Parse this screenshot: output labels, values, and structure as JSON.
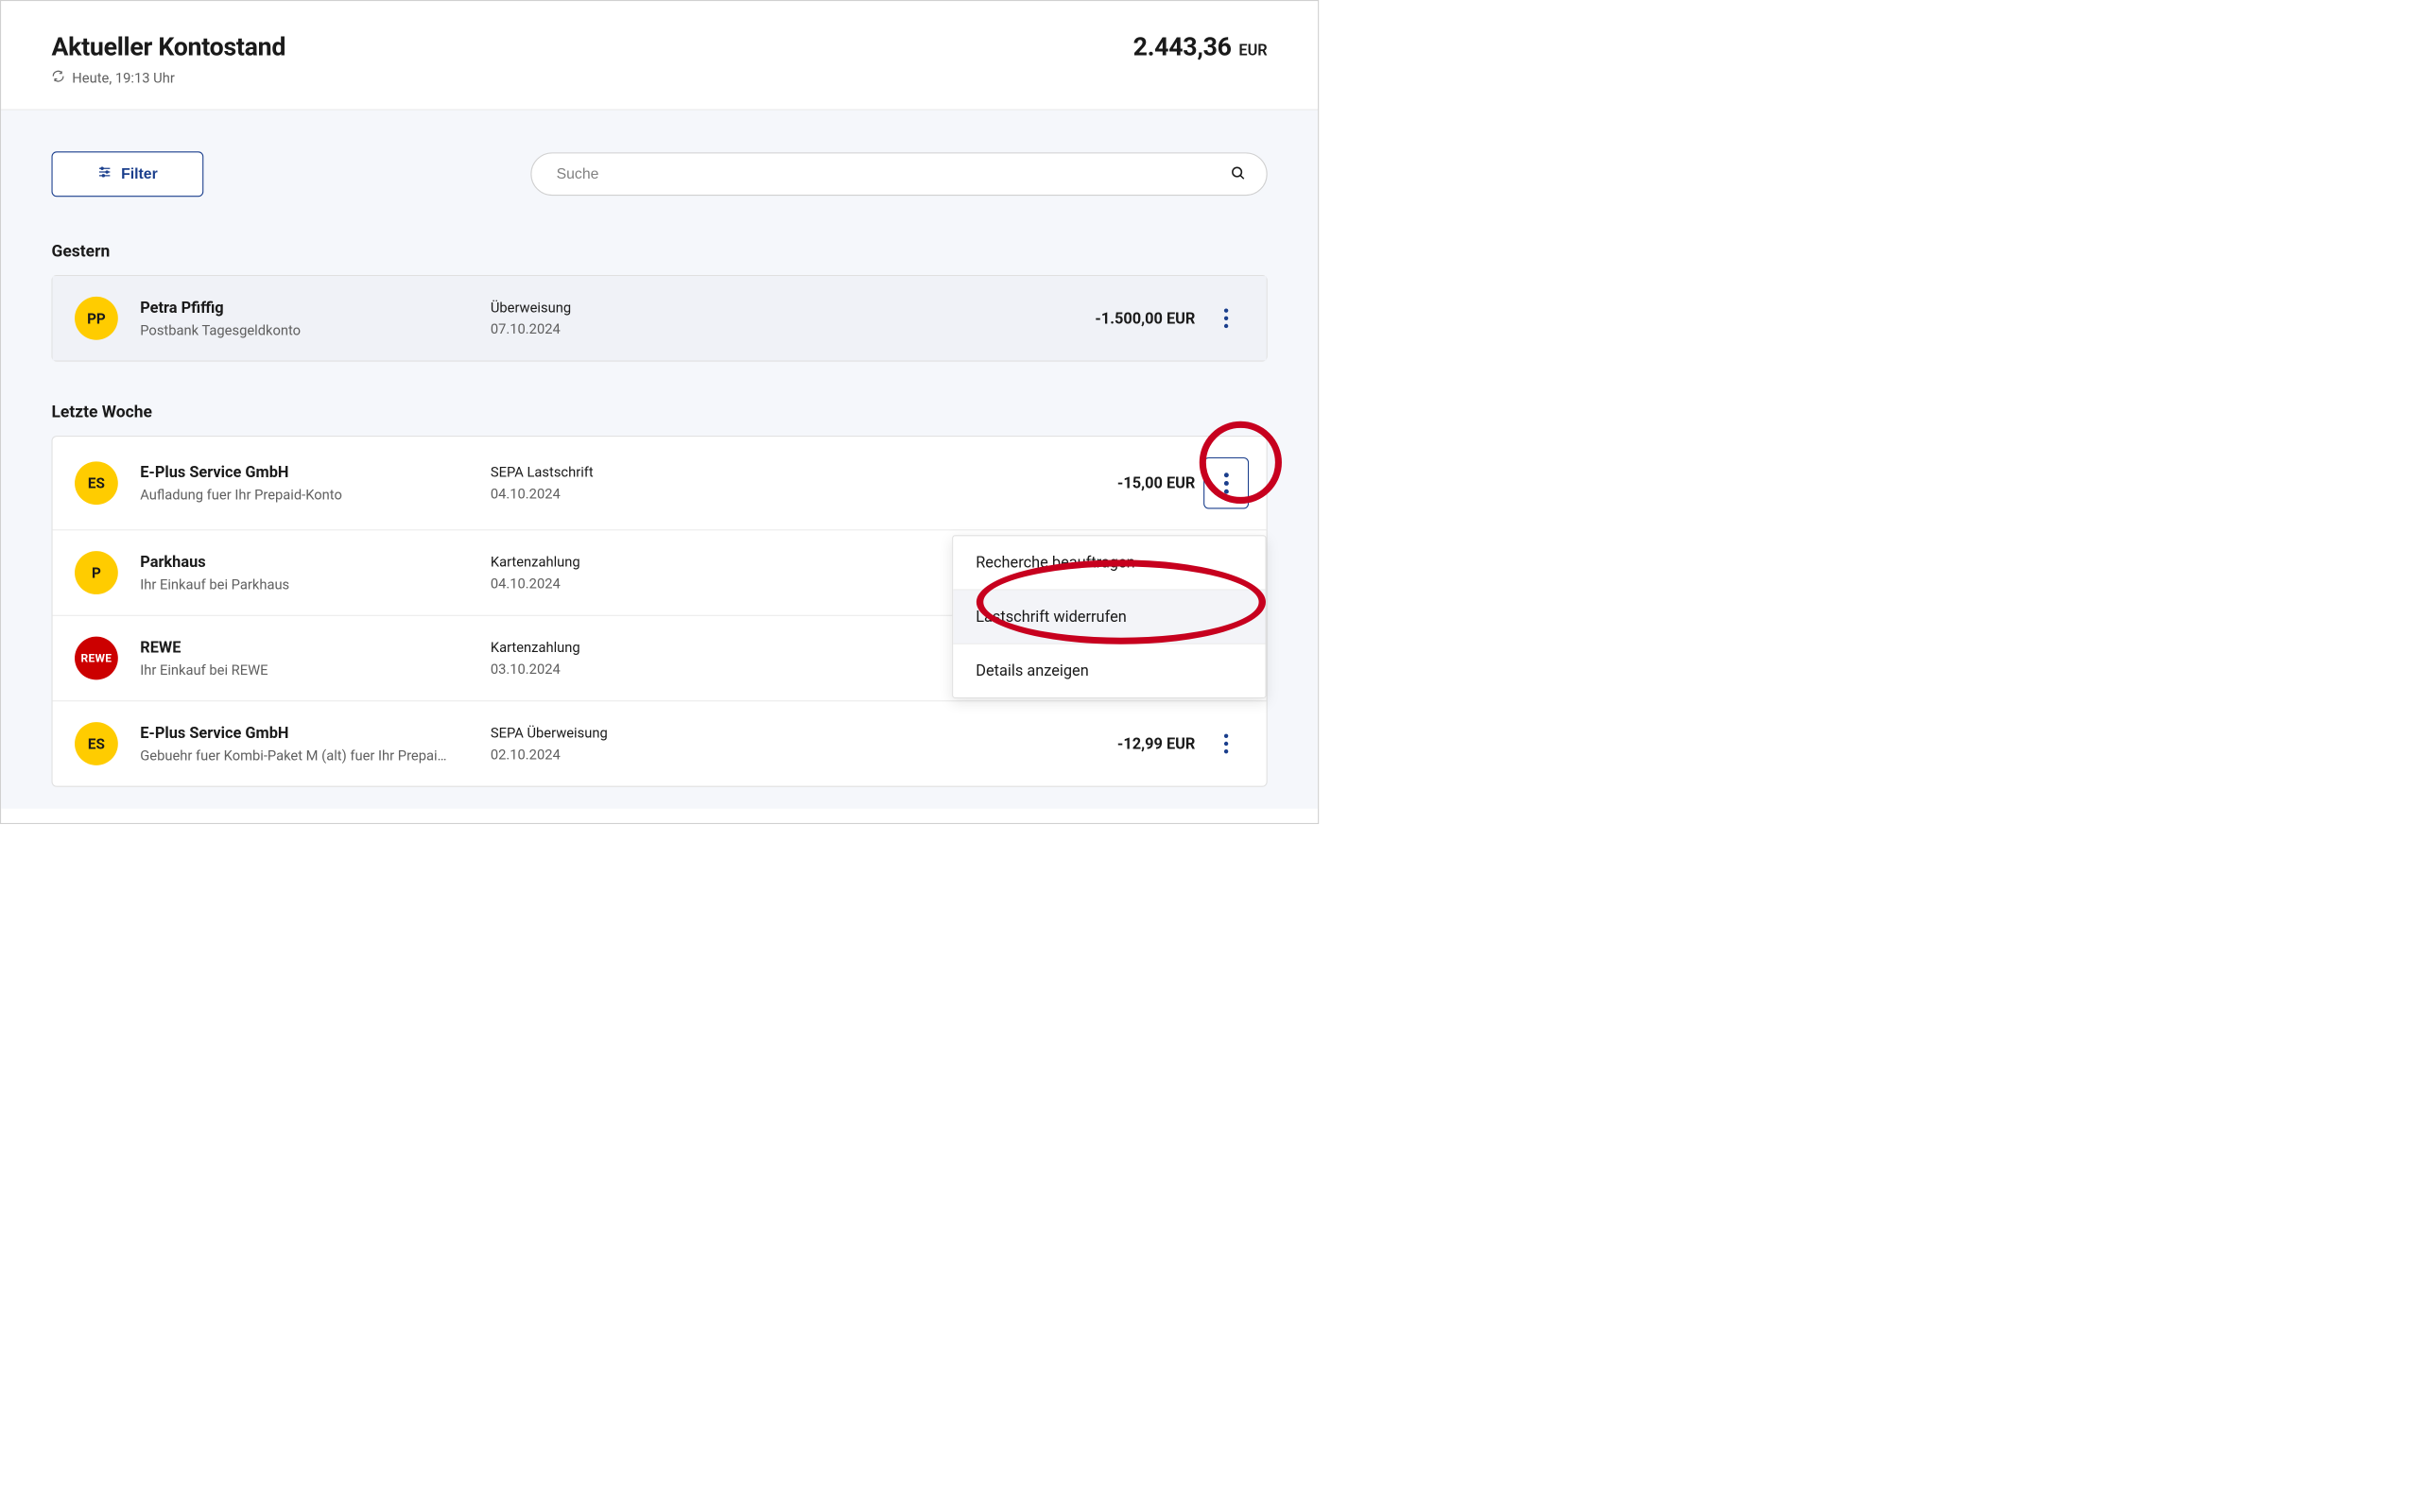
{
  "header": {
    "title": "Aktueller Kontostand",
    "timestamp": "Heute, 19:13 Uhr",
    "balance": "2.443,36",
    "currency": "EUR"
  },
  "controls": {
    "filter_label": "Filter",
    "search_placeholder": "Suche"
  },
  "sections": {
    "yesterday": "Gestern",
    "last_week": "Letzte Woche"
  },
  "yesterday_txns": [
    {
      "initials": "PP",
      "avatar_color": "yellow",
      "name": "Petra Pfiffig",
      "subtitle": "Postbank Tagesgeldkonto",
      "type": "Überweisung",
      "date": "07.10.2024",
      "amount": "-1.500,00 EUR"
    }
  ],
  "lastweek_txns": [
    {
      "initials": "ES",
      "avatar_color": "yellow",
      "name": "E-Plus Service GmbH",
      "subtitle": "Aufladung fuer Ihr Prepaid-Konto",
      "type": "SEPA Lastschrift",
      "date": "04.10.2024",
      "amount": "-15,00 EUR"
    },
    {
      "initials": "P",
      "avatar_color": "yellow",
      "name": "Parkhaus",
      "subtitle": "Ihr Einkauf bei Parkhaus",
      "type": "Kartenzahlung",
      "date": "04.10.2024",
      "amount": ""
    },
    {
      "initials": "REWE",
      "avatar_color": "rewe",
      "name": "REWE",
      "subtitle": "Ihr Einkauf bei REWE",
      "type": "Kartenzahlung",
      "date": "03.10.2024",
      "amount": ""
    },
    {
      "initials": "ES",
      "avatar_color": "yellow",
      "name": "E-Plus Service GmbH",
      "subtitle": "Gebuehr fuer Kombi-Paket M (alt) fuer Ihr Prepai…",
      "type": "SEPA Überweisung",
      "date": "02.10.2024",
      "amount": "-12,99 EUR"
    }
  ],
  "context_menu": {
    "item1": "Recherche beauftragen",
    "item2": "Lastschrift widerrufen",
    "item3": "Details anzeigen"
  }
}
